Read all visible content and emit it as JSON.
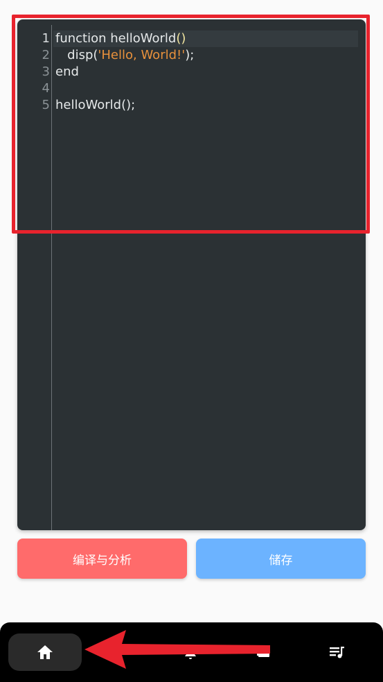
{
  "editor": {
    "lines": [
      {
        "number": "1",
        "parts": [
          {
            "t": "function helloWorld",
            "c": "plain"
          },
          {
            "t": "()",
            "c": "paren"
          }
        ]
      },
      {
        "number": "2",
        "parts": [
          {
            "t": "   disp(",
            "c": "plain"
          },
          {
            "t": "'Hello, World!'",
            "c": "string"
          },
          {
            "t": ");",
            "c": "plain"
          }
        ]
      },
      {
        "number": "3",
        "parts": [
          {
            "t": "end",
            "c": "plain"
          }
        ]
      },
      {
        "number": "4",
        "parts": []
      },
      {
        "number": "5",
        "parts": [
          {
            "t": "helloWorld();",
            "c": "plain"
          }
        ]
      }
    ]
  },
  "actions": {
    "compile_label": "编译与分析",
    "save_label": "储存"
  },
  "nav": {
    "items": [
      {
        "name": "home",
        "icon": "home-icon",
        "active": true
      },
      {
        "name": "notifications",
        "icon": "bell-icon",
        "active": false
      },
      {
        "name": "cards",
        "icon": "card-icon",
        "active": false
      },
      {
        "name": "playlist",
        "icon": "playlist-icon",
        "active": false
      }
    ]
  },
  "colors": {
    "editor_bg": "#2b3134",
    "string": "#e8913c",
    "compile_button": "#ff6b6b",
    "save_button": "#6cb3ff",
    "annotation": "#e8232d",
    "nav_bg": "#000000"
  }
}
